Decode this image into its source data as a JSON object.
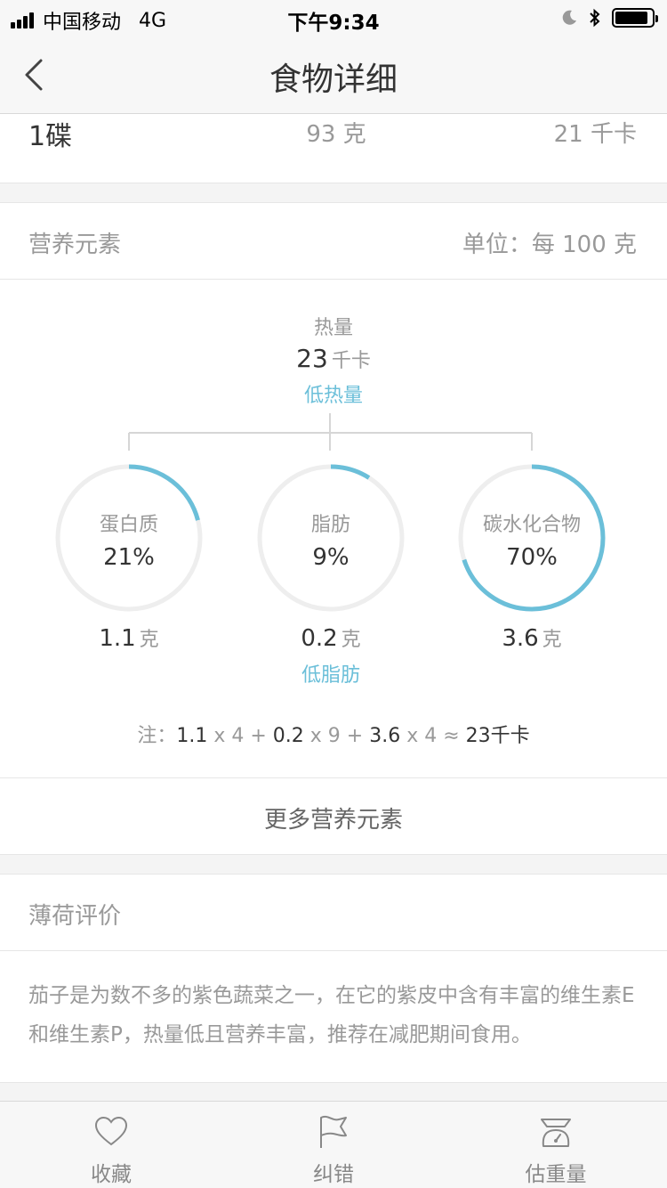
{
  "status_bar": {
    "carrier": "中国移动",
    "network": "4G",
    "time": "下午9:34"
  },
  "nav": {
    "title": "食物详细",
    "back_icon": "chevron-left-icon"
  },
  "serving": {
    "unit": "1碟",
    "grams_value": "93",
    "grams_unit": "克",
    "kcal_value": "21",
    "kcal_unit": "千卡"
  },
  "nutrition": {
    "section_label": "营养元素",
    "unit_note": "单位：每 100 克",
    "calories_label": "热量",
    "calories_value": "23",
    "calories_unit": "千卡",
    "calories_tag": "低热量",
    "accent_color": "#6bbfd9",
    "macros": [
      {
        "name": "蛋白质",
        "percent_label": "21%",
        "percent": 21,
        "amount": "1.1",
        "unit": "克",
        "tag": ""
      },
      {
        "name": "脂肪",
        "percent_label": "9%",
        "percent": 9,
        "amount": "0.2",
        "unit": "克",
        "tag": "低脂肪"
      },
      {
        "name": "碳水化合物",
        "percent_label": "70%",
        "percent": 70,
        "amount": "3.6",
        "unit": "克",
        "tag": ""
      }
    ],
    "formula": {
      "prefix": "注：",
      "p": "1.1",
      "x1": " x 4 + ",
      "f": "0.2",
      "x2": " x 9 + ",
      "c": "3.6",
      "x3": " x 4 ≈ ",
      "total": "23千卡"
    },
    "more_label": "更多营养元素"
  },
  "review": {
    "label": "薄荷评价",
    "text": "茄子是为数不多的紫色蔬菜之一，在它的紫皮中含有丰富的维生素E和维生素P，热量低且营养丰富，推荐在减肥期间食用。"
  },
  "tab_bar": {
    "items": [
      {
        "label": "收藏",
        "icon": "heart-icon"
      },
      {
        "label": "纠错",
        "icon": "flag-icon"
      },
      {
        "label": "估重量",
        "icon": "scale-icon"
      }
    ]
  }
}
